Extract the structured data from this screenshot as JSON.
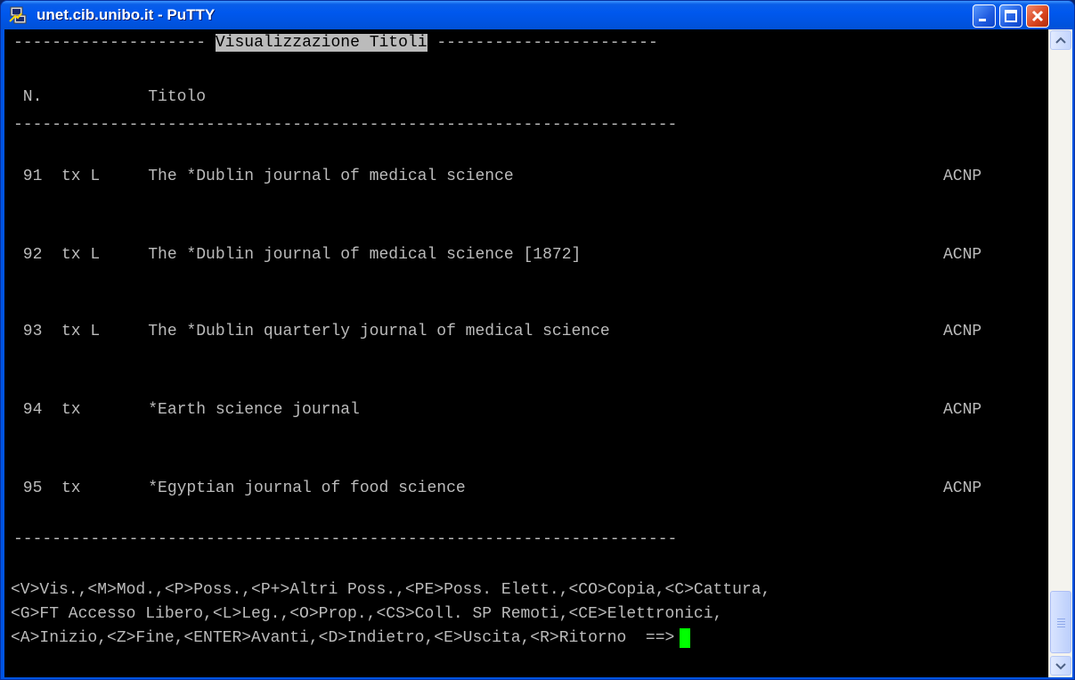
{
  "window": {
    "title": "unet.cib.unibo.it - PuTTY",
    "controls": [
      "minimize",
      "maximize",
      "close"
    ]
  },
  "terminal": {
    "header_left_dashes": "--------------------",
    "header_title": "Visualizzazione Titoli",
    "header_right_dashes": "-----------------------",
    "columns_line": " N.           Titolo",
    "separator_top": "---------------------------------------------------------------------",
    "rows": [
      {
        "text": " 91  tx L     The *Dublin journal of medical science",
        "source": "ACNP"
      },
      {
        "text": " 92  tx L     The *Dublin journal of medical science [1872]",
        "source": "ACNP"
      },
      {
        "text": " 93  tx L     The *Dublin quarterly journal of medical science",
        "source": "ACNP"
      },
      {
        "text": " 94  tx       *Earth science journal",
        "source": "ACNP"
      },
      {
        "text": " 95  tx       *Egyptian journal of food science",
        "source": "ACNP"
      }
    ],
    "separator_bottom": "---------------------------------------------------------------------",
    "commands": [
      "<V>Vis.,<M>Mod.,<P>Poss.,<P+>Altri Poss.,<PE>Poss. Elett.,<CO>Copia,<C>Cattura,",
      "<G>FT Accesso Libero,<L>Leg.,<O>Prop.,<CS>Coll. SP Remoti,<CE>Elettronici,",
      "<A>Inizio,<Z>Fine,<ENTER>Avanti,<D>Indietro,<E>Uscita,<R>Ritorno  ==>"
    ],
    "colors": {
      "background": "#000000",
      "text": "#bbbbbb",
      "cursor": "#00ff00",
      "highlight_bg": "#bbbbbb"
    }
  },
  "icons": {
    "app": "putty-icon",
    "scroll_up": "arrow-up-icon",
    "scroll_down": "arrow-down-icon"
  }
}
